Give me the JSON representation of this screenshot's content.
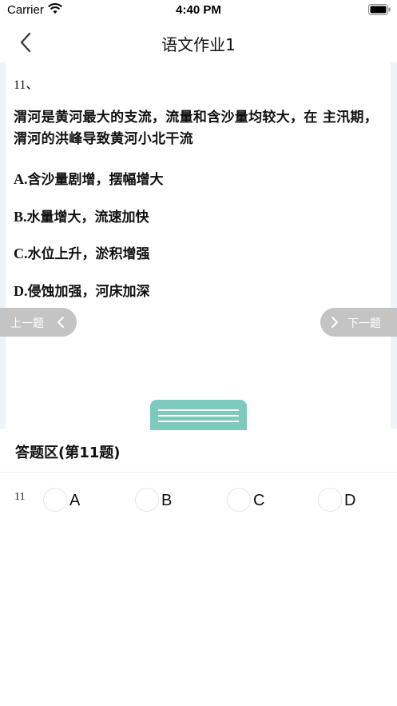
{
  "status_bar": {
    "carrier": "Carrier",
    "time": "4:40 PM"
  },
  "nav": {
    "title": "语文作业1",
    "back_icon": "chevron-left-icon"
  },
  "question": {
    "number": "11、",
    "stem": "渭河是黄河最大的支流，流量和含沙量均较大，在 主汛期，渭河的洪峰导致黄河小北干流",
    "options": [
      {
        "letter": "A.",
        "text": "含沙量剧增，摆幅增大"
      },
      {
        "letter": "B.",
        "text": "水量增大，流速加快"
      },
      {
        "letter": "C.",
        "text": "水位上升，淤积增强"
      },
      {
        "letter": "D.",
        "text": "侵蚀加强，河床加深"
      }
    ]
  },
  "pager": {
    "prev_label": "上一题",
    "next_label": "下一题"
  },
  "answer_sheet": {
    "title": "答题区(第11题)",
    "question_number": "11",
    "choices": [
      "A",
      "B",
      "C",
      "D"
    ],
    "selected": null
  },
  "colors": {
    "accent": "#7dc9bd",
    "pager_bg": "#c4c4c4",
    "question_area_bg": "#eef3f7"
  }
}
